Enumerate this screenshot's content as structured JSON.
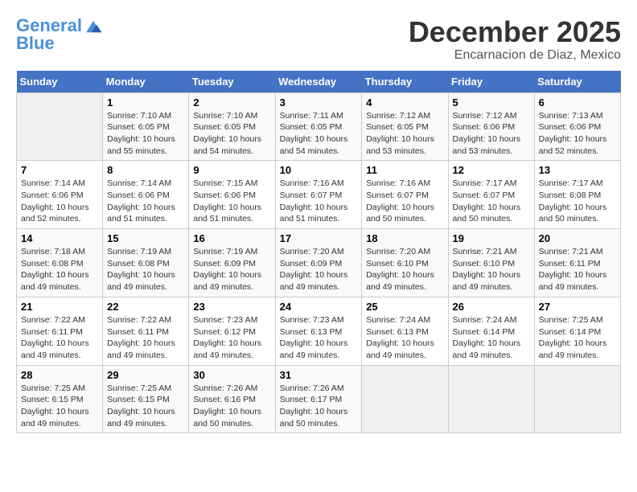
{
  "header": {
    "logo_line1": "General",
    "logo_line2": "Blue",
    "month": "December 2025",
    "location": "Encarnacion de Diaz, Mexico"
  },
  "weekdays": [
    "Sunday",
    "Monday",
    "Tuesday",
    "Wednesday",
    "Thursday",
    "Friday",
    "Saturday"
  ],
  "weeks": [
    [
      {
        "day": "",
        "info": ""
      },
      {
        "day": "1",
        "info": "Sunrise: 7:10 AM\nSunset: 6:05 PM\nDaylight: 10 hours\nand 55 minutes."
      },
      {
        "day": "2",
        "info": "Sunrise: 7:10 AM\nSunset: 6:05 PM\nDaylight: 10 hours\nand 54 minutes."
      },
      {
        "day": "3",
        "info": "Sunrise: 7:11 AM\nSunset: 6:05 PM\nDaylight: 10 hours\nand 54 minutes."
      },
      {
        "day": "4",
        "info": "Sunrise: 7:12 AM\nSunset: 6:05 PM\nDaylight: 10 hours\nand 53 minutes."
      },
      {
        "day": "5",
        "info": "Sunrise: 7:12 AM\nSunset: 6:06 PM\nDaylight: 10 hours\nand 53 minutes."
      },
      {
        "day": "6",
        "info": "Sunrise: 7:13 AM\nSunset: 6:06 PM\nDaylight: 10 hours\nand 52 minutes."
      }
    ],
    [
      {
        "day": "7",
        "info": "Sunrise: 7:14 AM\nSunset: 6:06 PM\nDaylight: 10 hours\nand 52 minutes."
      },
      {
        "day": "8",
        "info": "Sunrise: 7:14 AM\nSunset: 6:06 PM\nDaylight: 10 hours\nand 51 minutes."
      },
      {
        "day": "9",
        "info": "Sunrise: 7:15 AM\nSunset: 6:06 PM\nDaylight: 10 hours\nand 51 minutes."
      },
      {
        "day": "10",
        "info": "Sunrise: 7:16 AM\nSunset: 6:07 PM\nDaylight: 10 hours\nand 51 minutes."
      },
      {
        "day": "11",
        "info": "Sunrise: 7:16 AM\nSunset: 6:07 PM\nDaylight: 10 hours\nand 50 minutes."
      },
      {
        "day": "12",
        "info": "Sunrise: 7:17 AM\nSunset: 6:07 PM\nDaylight: 10 hours\nand 50 minutes."
      },
      {
        "day": "13",
        "info": "Sunrise: 7:17 AM\nSunset: 6:08 PM\nDaylight: 10 hours\nand 50 minutes."
      }
    ],
    [
      {
        "day": "14",
        "info": "Sunrise: 7:18 AM\nSunset: 6:08 PM\nDaylight: 10 hours\nand 49 minutes."
      },
      {
        "day": "15",
        "info": "Sunrise: 7:19 AM\nSunset: 6:08 PM\nDaylight: 10 hours\nand 49 minutes."
      },
      {
        "day": "16",
        "info": "Sunrise: 7:19 AM\nSunset: 6:09 PM\nDaylight: 10 hours\nand 49 minutes."
      },
      {
        "day": "17",
        "info": "Sunrise: 7:20 AM\nSunset: 6:09 PM\nDaylight: 10 hours\nand 49 minutes."
      },
      {
        "day": "18",
        "info": "Sunrise: 7:20 AM\nSunset: 6:10 PM\nDaylight: 10 hours\nand 49 minutes."
      },
      {
        "day": "19",
        "info": "Sunrise: 7:21 AM\nSunset: 6:10 PM\nDaylight: 10 hours\nand 49 minutes."
      },
      {
        "day": "20",
        "info": "Sunrise: 7:21 AM\nSunset: 6:11 PM\nDaylight: 10 hours\nand 49 minutes."
      }
    ],
    [
      {
        "day": "21",
        "info": "Sunrise: 7:22 AM\nSunset: 6:11 PM\nDaylight: 10 hours\nand 49 minutes."
      },
      {
        "day": "22",
        "info": "Sunrise: 7:22 AM\nSunset: 6:11 PM\nDaylight: 10 hours\nand 49 minutes."
      },
      {
        "day": "23",
        "info": "Sunrise: 7:23 AM\nSunset: 6:12 PM\nDaylight: 10 hours\nand 49 minutes."
      },
      {
        "day": "24",
        "info": "Sunrise: 7:23 AM\nSunset: 6:13 PM\nDaylight: 10 hours\nand 49 minutes."
      },
      {
        "day": "25",
        "info": "Sunrise: 7:24 AM\nSunset: 6:13 PM\nDaylight: 10 hours\nand 49 minutes."
      },
      {
        "day": "26",
        "info": "Sunrise: 7:24 AM\nSunset: 6:14 PM\nDaylight: 10 hours\nand 49 minutes."
      },
      {
        "day": "27",
        "info": "Sunrise: 7:25 AM\nSunset: 6:14 PM\nDaylight: 10 hours\nand 49 minutes."
      }
    ],
    [
      {
        "day": "28",
        "info": "Sunrise: 7:25 AM\nSunset: 6:15 PM\nDaylight: 10 hours\nand 49 minutes."
      },
      {
        "day": "29",
        "info": "Sunrise: 7:25 AM\nSunset: 6:15 PM\nDaylight: 10 hours\nand 49 minutes."
      },
      {
        "day": "30",
        "info": "Sunrise: 7:26 AM\nSunset: 6:16 PM\nDaylight: 10 hours\nand 50 minutes."
      },
      {
        "day": "31",
        "info": "Sunrise: 7:26 AM\nSunset: 6:17 PM\nDaylight: 10 hours\nand 50 minutes."
      },
      {
        "day": "",
        "info": ""
      },
      {
        "day": "",
        "info": ""
      },
      {
        "day": "",
        "info": ""
      }
    ]
  ]
}
